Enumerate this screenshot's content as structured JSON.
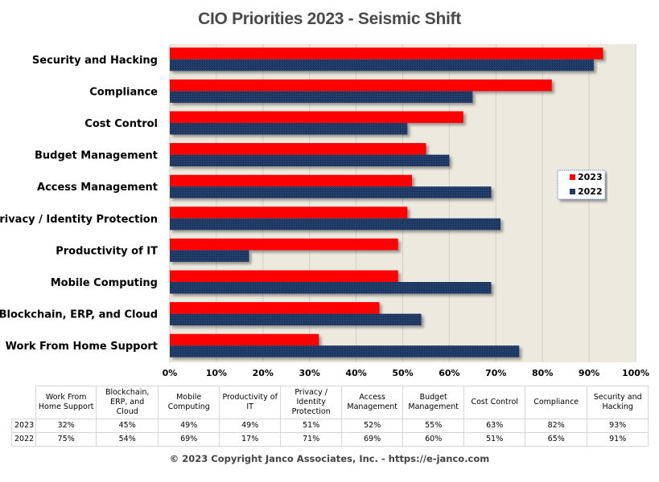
{
  "chart_data": {
    "type": "bar",
    "orientation": "horizontal",
    "title": "CIO Priorities 2023 - Seismic Shift",
    "xlabel": "",
    "ylabel": "",
    "xlim": [
      0,
      100
    ],
    "x_ticks": [
      "0%",
      "10%",
      "20%",
      "30%",
      "40%",
      "50%",
      "60%",
      "70%",
      "80%",
      "90%",
      "100%"
    ],
    "grid": true,
    "legend_position": "right",
    "categories": [
      "Security and Hacking",
      "Compliance",
      "Cost Control",
      "Budget Management",
      "Access Management",
      "Privacy / Identity Protection",
      "Productivity of IT",
      "Mobile Computing",
      "Blockchain, ERP, and Cloud",
      "Work From Home Support"
    ],
    "series": [
      {
        "name": "2023",
        "color": "#ff0000",
        "values": [
          93,
          82,
          63,
          55,
          52,
          51,
          49,
          49,
          45,
          32
        ]
      },
      {
        "name": "2022",
        "color": "#1f3864",
        "values": [
          91,
          65,
          51,
          60,
          69,
          71,
          17,
          69,
          54,
          75
        ]
      }
    ],
    "plot_background": "#ece9df"
  },
  "table": {
    "columns": [
      "Work From Home Support",
      "Blockchain, ERP, and Cloud",
      "Mobile Computing",
      "Productivity of IT",
      "Privacy / Identity Protection",
      "Access Management",
      "Budget Management",
      "Cost Control",
      "Compliance",
      "Security and Hacking"
    ],
    "rows": [
      {
        "label": "2023",
        "values": [
          "32%",
          "45%",
          "49%",
          "49%",
          "51%",
          "52%",
          "55%",
          "63%",
          "82%",
          "93%"
        ]
      },
      {
        "label": "2022",
        "values": [
          "75%",
          "54%",
          "69%",
          "17%",
          "71%",
          "69%",
          "60%",
          "51%",
          "65%",
          "91%"
        ]
      }
    ]
  },
  "footer": {
    "copyright": "© 2023 Copyright Janco Associates, Inc. - https://e-janco.com"
  }
}
